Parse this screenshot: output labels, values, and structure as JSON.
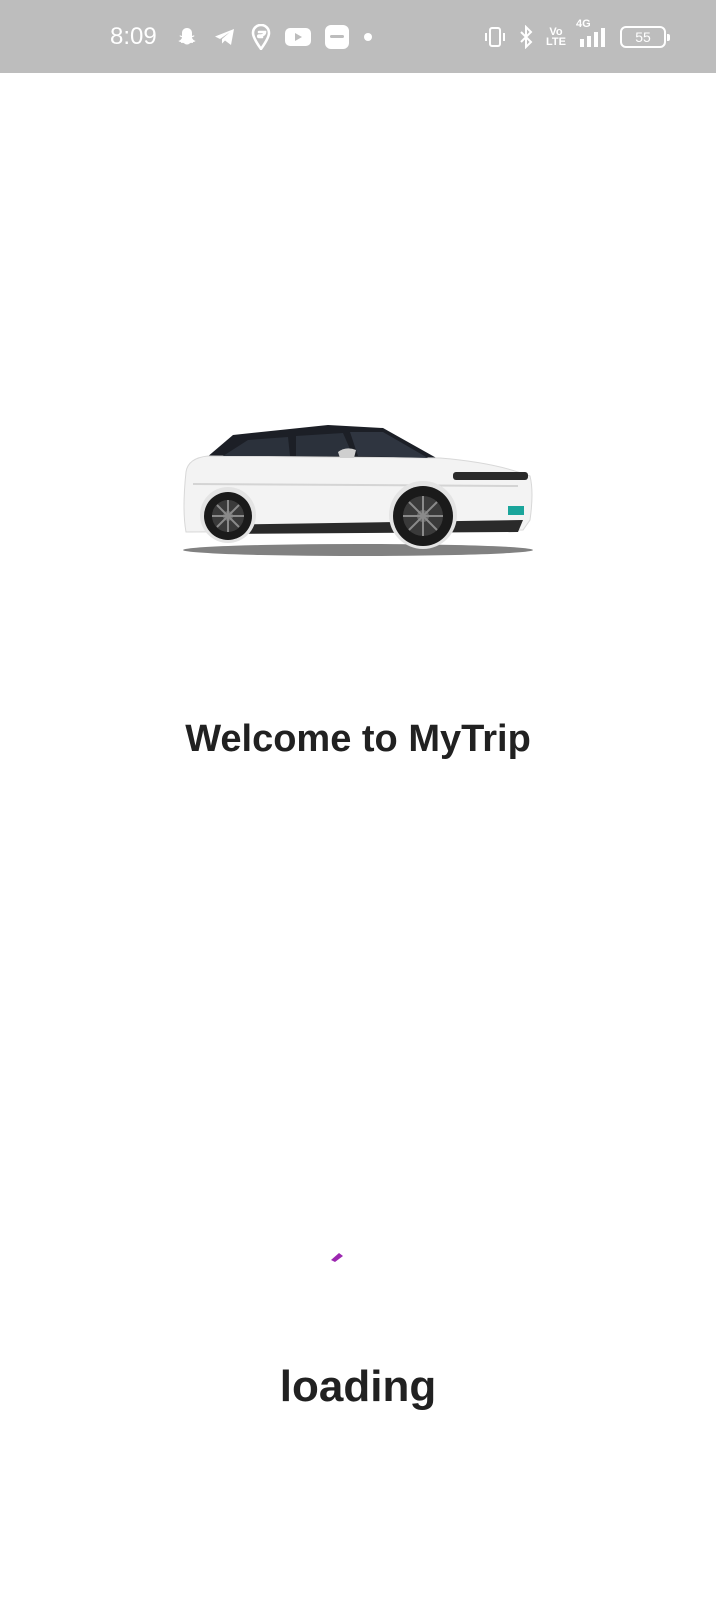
{
  "status_bar": {
    "time": "8:09",
    "network_label": "4G",
    "volte_label_top": "Vo",
    "volte_label_bottom": "LTE",
    "battery_level": "55",
    "notification_icons": [
      "snapchat-icon",
      "telegram-icon",
      "swiggy-icon",
      "youtube-icon",
      "jiocinema-icon",
      "dot-icon"
    ],
    "system_icons": [
      "vibrate-icon",
      "bluetooth-icon",
      "volte-icon",
      "signal-icon",
      "battery-icon"
    ]
  },
  "main": {
    "welcome_text": "Welcome to MyTrip",
    "loading_text": "loading",
    "spinner_color": "#9c27b0"
  },
  "colors": {
    "status_bar_bg": "#bdbdbd",
    "text_primary": "#212121",
    "background": "#ffffff"
  }
}
